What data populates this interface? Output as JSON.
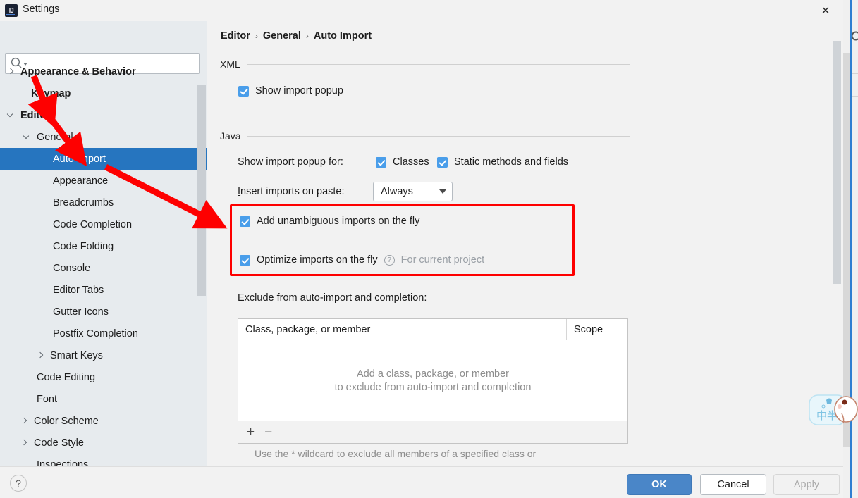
{
  "window": {
    "title": "Settings",
    "app_icon": "intellij-idea-icon",
    "close_label": "✕"
  },
  "sidebar": {
    "search": {
      "placeholder": "",
      "value": "",
      "icon": "search-icon"
    },
    "items": [
      {
        "label": "Appearance & Behavior",
        "indent": 8,
        "twisty": "right",
        "bold": true,
        "selected": false
      },
      {
        "label": "Keymap",
        "indent": 23,
        "twisty": "none",
        "bold": true,
        "selected": false
      },
      {
        "label": "Editor",
        "indent": 8,
        "twisty": "down",
        "bold": true,
        "selected": false
      },
      {
        "label": "General",
        "indent": 31,
        "twisty": "down",
        "bold": false,
        "selected": false
      },
      {
        "label": "Auto Import",
        "indent": 54,
        "twisty": "none",
        "bold": false,
        "selected": true
      },
      {
        "label": "Appearance",
        "indent": 54,
        "twisty": "none",
        "bold": false,
        "selected": false
      },
      {
        "label": "Breadcrumbs",
        "indent": 54,
        "twisty": "none",
        "bold": false,
        "selected": false
      },
      {
        "label": "Code Completion",
        "indent": 54,
        "twisty": "none",
        "bold": false,
        "selected": false
      },
      {
        "label": "Code Folding",
        "indent": 54,
        "twisty": "none",
        "bold": false,
        "selected": false
      },
      {
        "label": "Console",
        "indent": 54,
        "twisty": "none",
        "bold": false,
        "selected": false
      },
      {
        "label": "Editor Tabs",
        "indent": 54,
        "twisty": "none",
        "bold": false,
        "selected": false
      },
      {
        "label": "Gutter Icons",
        "indent": 54,
        "twisty": "none",
        "bold": false,
        "selected": false
      },
      {
        "label": "Postfix Completion",
        "indent": 54,
        "twisty": "none",
        "bold": false,
        "selected": false
      },
      {
        "label": "Smart Keys",
        "indent": 50,
        "twisty": "right",
        "bold": false,
        "selected": false
      },
      {
        "label": "Code Editing",
        "indent": 31,
        "twisty": "none",
        "bold": false,
        "selected": false
      },
      {
        "label": "Font",
        "indent": 31,
        "twisty": "none",
        "bold": false,
        "selected": false
      },
      {
        "label": "Color Scheme",
        "indent": 27,
        "twisty": "right",
        "bold": false,
        "selected": false
      },
      {
        "label": "Code Style",
        "indent": 27,
        "twisty": "right",
        "bold": false,
        "selected": false
      },
      {
        "label": "Inspections",
        "indent": 31,
        "twisty": "none",
        "bold": false,
        "selected": false
      }
    ]
  },
  "breadcrumb": {
    "part1": "Editor",
    "sep1": "›",
    "part2": "General",
    "sep2": "›",
    "part3": "Auto Import"
  },
  "xml_section": {
    "title": "XML",
    "show_import_popup": {
      "label": "Show import popup",
      "checked": true
    }
  },
  "java_section": {
    "title": "Java",
    "show_import_popup_for_label": "Show import popup for:",
    "classes": {
      "label": "Classes",
      "mnemonic": "C",
      "rest": "lasses",
      "checked": true
    },
    "static_methods": {
      "label": "Static methods and fields",
      "mnemonic": "S",
      "rest": "tatic methods and fields",
      "checked": true
    },
    "insert_imports_label": "Insert imports on paste:",
    "insert_imports_mnemonic": "I",
    "insert_imports_rest": "nsert imports on paste:",
    "insert_imports_value": "Always",
    "add_unambiguous": {
      "label": "Add unambiguous imports on the fly",
      "checked": true
    },
    "optimize_imports": {
      "label": "Optimize imports on the fly",
      "checked": true
    },
    "optimize_help_icon": "question-mark-icon",
    "optimize_scope_note": "For current project"
  },
  "exclude_section": {
    "label": "Exclude from auto-import and completion:",
    "columns": [
      "Class, package, or member",
      "Scope"
    ],
    "rows": [],
    "empty_line1": "Add a class, package, or member",
    "empty_line2": "to exclude from auto-import and completion",
    "add_button": "+",
    "remove_button": "−",
    "hint": "Use the * wildcard to exclude all members of a specified class or"
  },
  "footer": {
    "help": "?",
    "ok": "OK",
    "cancel": "Cancel",
    "apply": "Apply"
  },
  "annotations": {
    "arrow_color": "#fe0000",
    "highlight_box_color": "#fe0000"
  },
  "colors": {
    "selection_blue": "#2675bf",
    "checkbox_blue": "#4a9eea",
    "primary_button": "#4a86c8",
    "sidebar_bg": "#e7ebee",
    "panel_bg": "#f2f2f2"
  }
}
